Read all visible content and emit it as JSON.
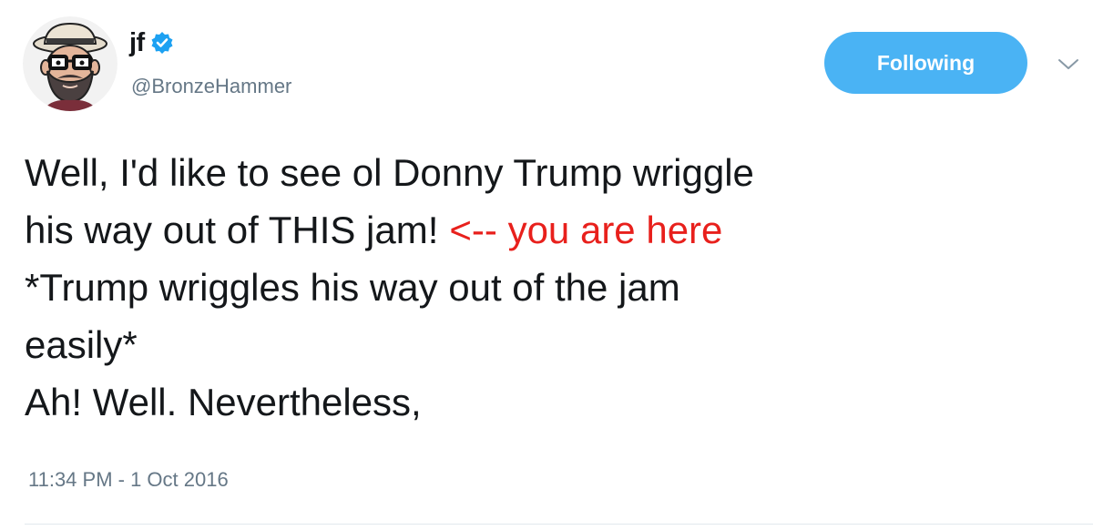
{
  "user": {
    "display_name": "jf",
    "handle": "@BronzeHammer",
    "verified": true,
    "avatar_icon": "bearded-man-with-glasses-avatar"
  },
  "follow_button": {
    "label": "Following",
    "color": "#4ab3f4"
  },
  "menu_icon": "chevron-down-icon",
  "tweet": {
    "lines": [
      "Well, I'd like to see ol Donny Trump wriggle",
      "his way out of THIS jam!",
      "*Trump wriggles his way out of the jam",
      "easily*",
      "Ah! Well. Nevertheless,"
    ],
    "annotation": "<-- you are here",
    "annotation_color": "#e8201c",
    "timestamp": "11:34 PM - 1 Oct 2016"
  },
  "colors": {
    "text": "#14171a",
    "secondary_text": "#657786",
    "verified_badge": "#1da1f2"
  }
}
